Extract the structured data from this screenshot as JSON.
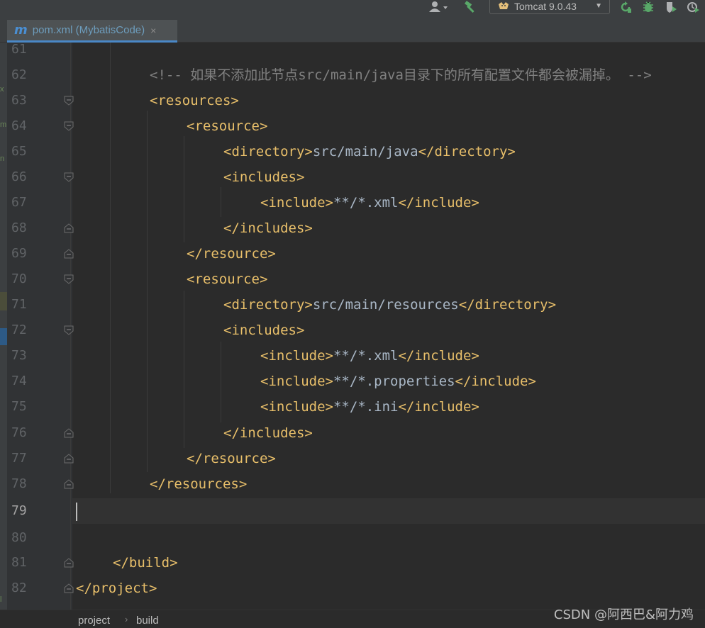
{
  "toolbar": {
    "run_config_label": "Tomcat 9.0.43",
    "icons": [
      "user-icon",
      "hammer-icon",
      "tomcat-icon",
      "rerun-icon",
      "debug-icon",
      "coverage-icon",
      "profile-icon"
    ]
  },
  "tab": {
    "icon_letter": "m",
    "label": "pom.xml (MybatisCode)",
    "close": "×"
  },
  "editor": {
    "current_line": "79",
    "lines": [
      {
        "n": "61",
        "code": ""
      },
      {
        "n": "62",
        "code": "<!-- 如果不添加此节点src/main/java目录下的所有配置文件都会被漏掉。 -->"
      },
      {
        "n": "63",
        "code": "<resources>"
      },
      {
        "n": "64",
        "code": "<resource>"
      },
      {
        "n": "65",
        "open": "<directory>",
        "text": "src/main/java",
        "close": "</directory>"
      },
      {
        "n": "66",
        "code": "<includes>"
      },
      {
        "n": "67",
        "open": "<include>",
        "text": "**/*.xml",
        "close": "</include>"
      },
      {
        "n": "68",
        "code": "</includes>"
      },
      {
        "n": "69",
        "code": "</resource>"
      },
      {
        "n": "70",
        "code": "<resource>"
      },
      {
        "n": "71",
        "open": "<directory>",
        "text": "src/main/resources",
        "close": "</directory>"
      },
      {
        "n": "72",
        "code": "<includes>"
      },
      {
        "n": "73",
        "open": "<include>",
        "text": "**/*.xml",
        "close": "</include>"
      },
      {
        "n": "74",
        "open": "<include>",
        "text": "**/*.properties",
        "close": "</include>"
      },
      {
        "n": "75",
        "open": "<include>",
        "text": "**/*.ini",
        "close": "</include>"
      },
      {
        "n": "76",
        "code": "</includes>"
      },
      {
        "n": "77",
        "code": "</resource>"
      },
      {
        "n": "78",
        "code": "</resources>"
      },
      {
        "n": "79",
        "code": ""
      },
      {
        "n": "80",
        "code": ""
      },
      {
        "n": "81",
        "code": "</build>"
      },
      {
        "n": "82",
        "code": "</project>"
      }
    ]
  },
  "breadcrumb": {
    "items": [
      "project",
      "build"
    ]
  },
  "watermark": "CSDN @阿西巴&阿力鸡"
}
